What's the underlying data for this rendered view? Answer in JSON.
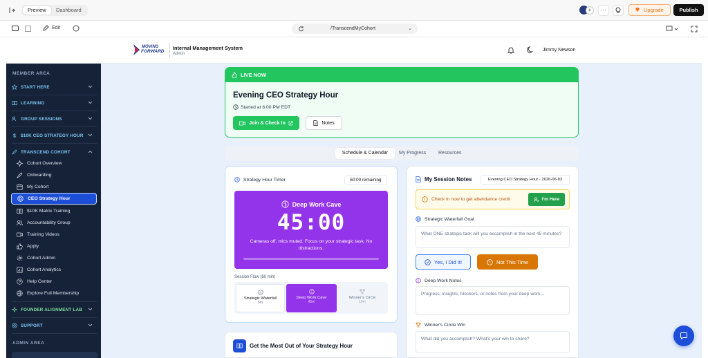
{
  "browser": {
    "tabs": [
      {
        "label": "Preview",
        "active": true
      },
      {
        "label": "Dashboard",
        "active": false
      }
    ],
    "upgrade_label": "Upgrade",
    "publish_label": "Publish",
    "edit_label": "Edit",
    "url": "/TranscendMyCohort"
  },
  "app": {
    "logo_line1": "MOVING",
    "logo_line2": "FORWARD",
    "system_title": "Internal Management System",
    "role": "Admin",
    "user_name": "Jimmy Newson"
  },
  "sidebar": {
    "member_area": "MEMBER AREA",
    "sections": [
      {
        "label": "START HERE",
        "icon": "star-icon"
      },
      {
        "label": "LEARNING",
        "icon": "book-icon"
      },
      {
        "label": "GROUP SESSIONS",
        "icon": "users-icon"
      },
      {
        "label": "$10K CEO STRATEGY HOUR",
        "icon": "dollar-icon"
      },
      {
        "label": "TRANSCEND COHORT",
        "icon": "rocket-icon",
        "expanded": true
      }
    ],
    "cohort_items": [
      {
        "label": "Cohort Overview",
        "icon": "sparkle-icon"
      },
      {
        "label": "Onboarding",
        "icon": "rocket-icon"
      },
      {
        "label": "My Cohort",
        "icon": "calendar-icon"
      },
      {
        "label": "CEO Strategy Hour",
        "icon": "target-icon",
        "active": true
      },
      {
        "label": "$10K Matrix Training",
        "icon": "book-open-icon"
      },
      {
        "label": "Accountability Group",
        "icon": "users-icon"
      },
      {
        "label": "Training Videos",
        "icon": "video-icon"
      },
      {
        "label": "Apply",
        "icon": "thumbs-up-icon"
      },
      {
        "label": "Cohort Admin",
        "icon": "gear-icon"
      },
      {
        "label": "Cohort Analytics",
        "icon": "chart-icon"
      },
      {
        "label": "Help Center",
        "icon": "help-icon"
      },
      {
        "label": "Explore Full Membership",
        "icon": "globe-icon"
      }
    ],
    "founder_section": "FOUNDER ALIGNMENT LAB",
    "support_section": "SUPPORT",
    "admin_area": "ADMIN AREA"
  },
  "live": {
    "banner": "LIVE NOW",
    "title": "Evening CEO Strategy Hour",
    "started": "Started at 6:00 PM EDT",
    "join_label": "Join & Check In",
    "notes_label": "Notes"
  },
  "tabs": [
    {
      "label": "Schedule & Calendar",
      "active": true
    },
    {
      "label": "My Progress",
      "active": false
    },
    {
      "label": "Resources",
      "active": false
    }
  ],
  "timer": {
    "title": "Strategy Hour Timer",
    "remaining": "60:00 remaining",
    "phase_title": "Deep Work Cave",
    "time": "45:00",
    "message": "Cameras off, mics muted. Focus on your strategic task. No distractions.",
    "progress": 0,
    "flow_label": "Session Flow (60 min)",
    "flow": [
      {
        "name": "Strategic Waterfall",
        "dur": "5m"
      },
      {
        "name": "Deep Work Cave",
        "dur": "45m",
        "active": true
      },
      {
        "name": "Winner's Circle",
        "dur": "10m"
      }
    ]
  },
  "resource_card": {
    "title": "Get the Most Out of Your Strategy Hour"
  },
  "notes": {
    "title": "My Session Notes",
    "session_select": "Evening CEO Strategy Hour - 2026-06-02",
    "checkin_prompt": "Check in now to get attendance credit",
    "im_here_label": "I'm Here",
    "goal_label": "Strategic Waterfall Goal",
    "goal_placeholder": "What ONE strategic task will you accomplish in the next 45 minutes?",
    "did_it_label": "Yes, I Did It!",
    "not_time_label": "Not This Time",
    "deep_label": "Deep Work Notes",
    "deep_placeholder": "Progress, insights, blockers, or notes from your deep work...",
    "win_label": "Winner's Circle Win",
    "win_placeholder": "What did you accomplish? What's your win to share?"
  },
  "colors": {
    "accent": "#1d4ed8",
    "live_green": "#22c55e",
    "purple": "#9333ea",
    "orange": "#d97706",
    "sidebar": "#152238"
  }
}
